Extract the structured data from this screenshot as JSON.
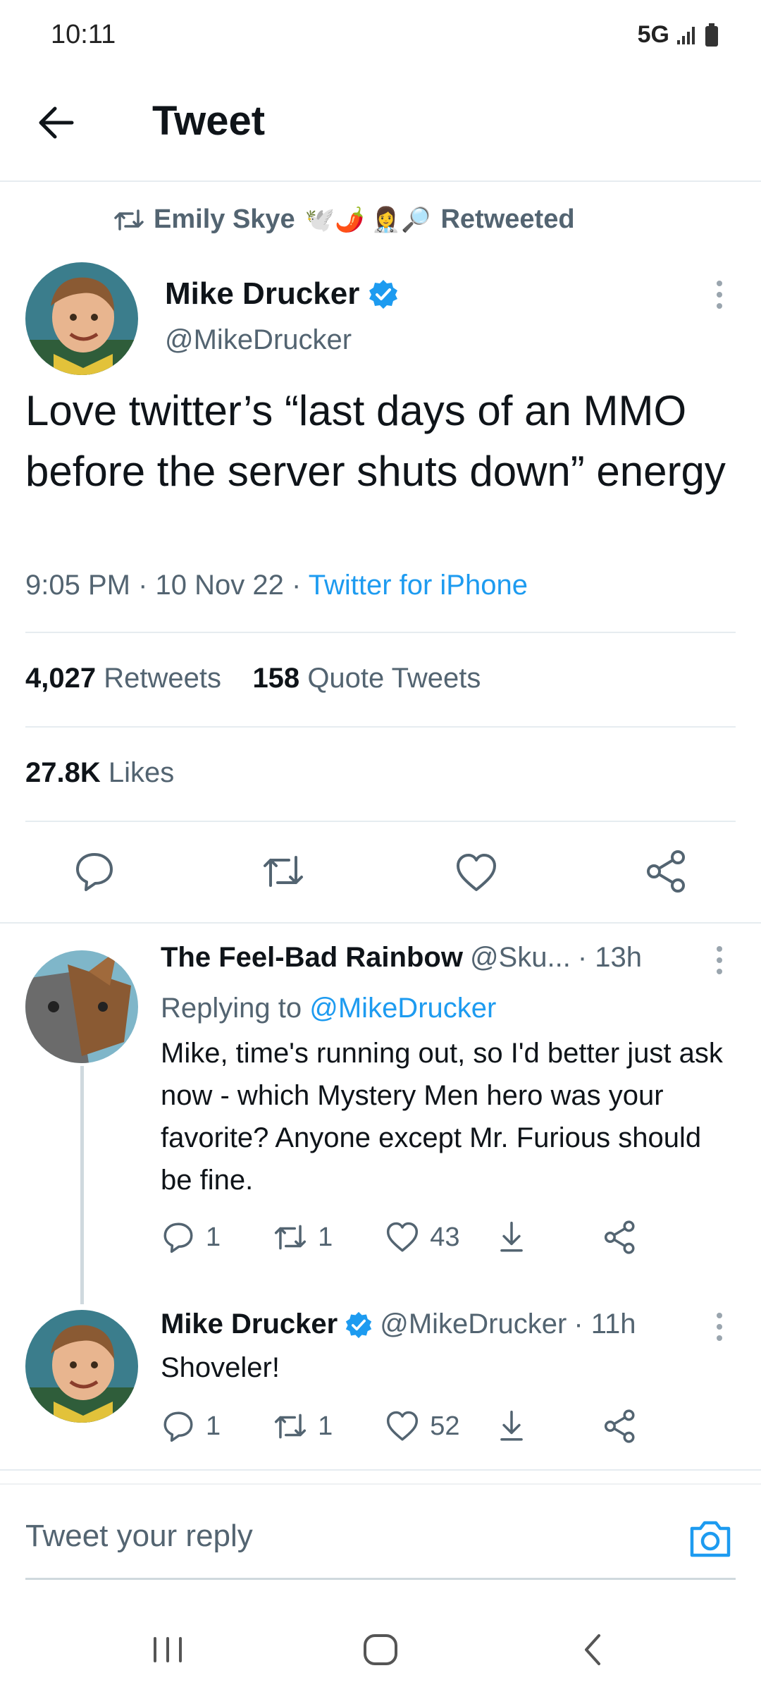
{
  "status_bar": {
    "time": "10:11",
    "network": "5G"
  },
  "header": {
    "title": "Tweet"
  },
  "retweet_context": {
    "name": "Emily Skye",
    "emojis": "🕊️🌶️ 👩‍⚕️🔎",
    "label": "Retweeted"
  },
  "tweet": {
    "author_name": "Mike Drucker",
    "author_handle": "@MikeDrucker",
    "text": "Love twitter’s “last days of an MMO before the server shuts down” energy",
    "time": "9:05 PM",
    "date": "10 Nov 22",
    "source": "Twitter for iPhone",
    "retweets_count": "4,027",
    "retweets_label": "Retweets",
    "quotes_count": "158",
    "quotes_label": "Quote Tweets",
    "likes_count": "27.8K",
    "likes_label": "Likes"
  },
  "replies": [
    {
      "name": "The Feel-Bad Rainbow",
      "handle": "@Sku...",
      "time": "· 13h",
      "replying_label": "Replying to",
      "replying_handle": "@MikeDrucker",
      "text": "Mike, time's running out, so I'd better just ask now - which Mystery Men hero was your favorite? Anyone except Mr. Furious should be fine.",
      "replies": "1",
      "retweets": "1",
      "likes": "43"
    },
    {
      "name": "Mike Drucker",
      "handle": "@MikeDrucker",
      "time": "· 11h",
      "text": "Shoveler!",
      "replies": "1",
      "retweets": "1",
      "likes": "52"
    }
  ],
  "composer": {
    "placeholder": "Tweet your reply"
  },
  "colors": {
    "accent": "#1d9bf0",
    "text": "#0f1419",
    "muted": "#536471"
  }
}
